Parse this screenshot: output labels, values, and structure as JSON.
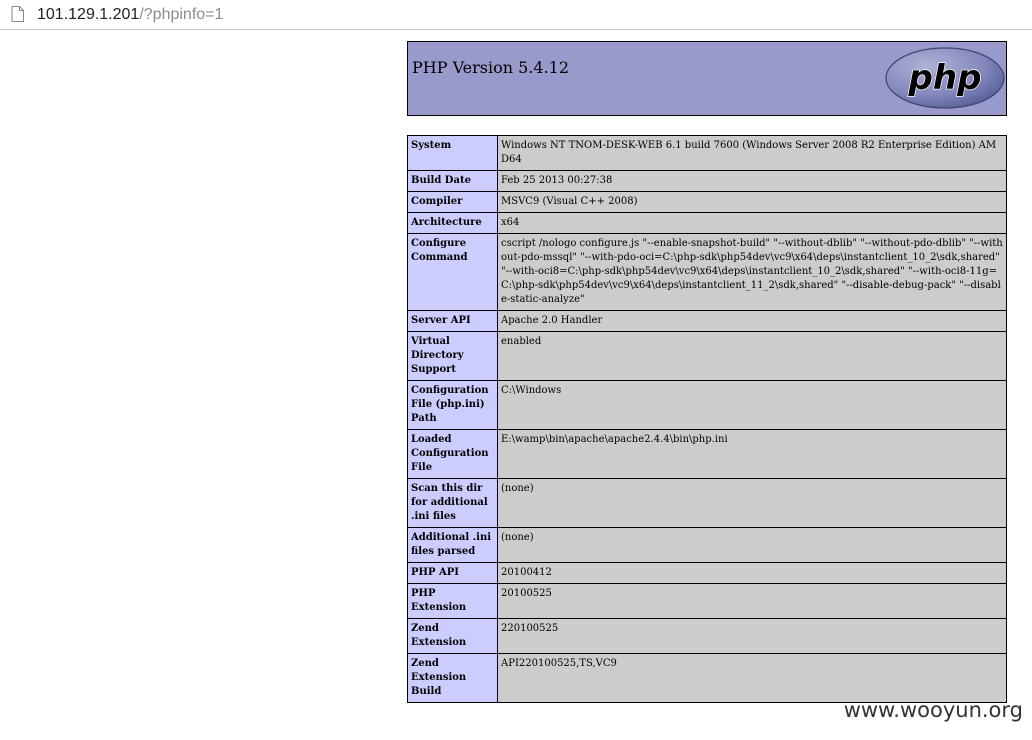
{
  "browser": {
    "url_host": "101.129.1.201",
    "url_path": "/?phpinfo=1",
    "page_icon": "page-icon"
  },
  "phpinfo": {
    "title": "PHP Version 5.4.12",
    "logo_text": "php",
    "rows": [
      {
        "key": "System",
        "value": "Windows NT TNOM-DESK-WEB 6.1 build 7600 (Windows Server 2008 R2 Enterprise Edition) AMD64"
      },
      {
        "key": "Build Date",
        "value": "Feb 25 2013 00:27:38"
      },
      {
        "key": "Compiler",
        "value": "MSVC9 (Visual C++ 2008)"
      },
      {
        "key": "Architecture",
        "value": "x64"
      },
      {
        "key": "Configure Command",
        "value": "cscript /nologo configure.js \"--enable-snapshot-build\" \"--without-dblib\" \"--without-pdo-dblib\" \"--without-pdo-mssql\" \"--with-pdo-oci=C:\\php-sdk\\php54dev\\vc9\\x64\\deps\\instantclient_10_2\\sdk,shared\" \"--with-oci8=C:\\php-sdk\\php54dev\\vc9\\x64\\deps\\instantclient_10_2\\sdk,shared\" \"--with-oci8-11g=C:\\php-sdk\\php54dev\\vc9\\x64\\deps\\instantclient_11_2\\sdk,shared\" \"--disable-debug-pack\" \"--disable-static-analyze\""
      },
      {
        "key": "Server API",
        "value": "Apache 2.0 Handler"
      },
      {
        "key": "Virtual Directory Support",
        "value": "enabled"
      },
      {
        "key": "Configuration File (php.ini) Path",
        "value": "C:\\Windows"
      },
      {
        "key": "Loaded Configuration File",
        "value": "E:\\wamp\\bin\\apache\\apache2.4.4\\bin\\php.ini"
      },
      {
        "key": "Scan this dir for additional .ini files",
        "value": "(none)"
      },
      {
        "key": "Additional .ini files parsed",
        "value": "(none)"
      },
      {
        "key": "PHP API",
        "value": "20100412"
      },
      {
        "key": "PHP Extension",
        "value": "20100525"
      },
      {
        "key": "Zend Extension",
        "value": "220100525"
      },
      {
        "key": "Zend Extension Build",
        "value": "API220100525,TS,VC9"
      }
    ]
  },
  "watermark": "www.wooyun.org",
  "colors": {
    "header_bg": "#9999cc",
    "key_bg": "#ccccff",
    "value_bg": "#cccccc"
  }
}
